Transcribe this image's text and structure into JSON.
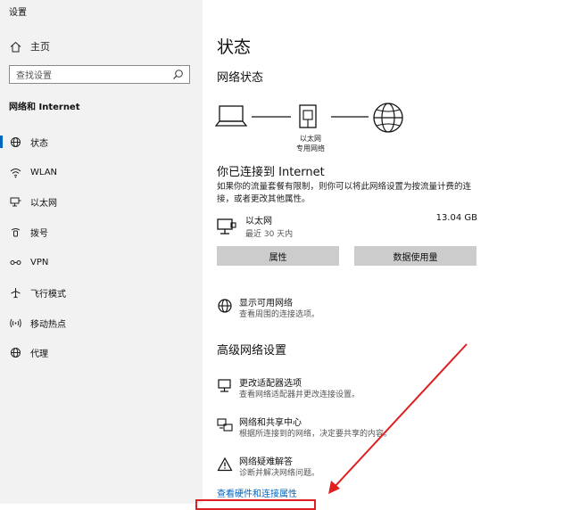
{
  "window": {
    "title": "设置"
  },
  "sidebar": {
    "home_label": "主页",
    "search_placeholder": "查找设置",
    "section_title": "网络和 Internet",
    "items": [
      {
        "label": "状态",
        "icon": "globe-status-icon",
        "active": true
      },
      {
        "label": "WLAN",
        "icon": "wifi-icon",
        "active": false
      },
      {
        "label": "以太网",
        "icon": "ethernet-icon",
        "active": false
      },
      {
        "label": "拨号",
        "icon": "dialup-icon",
        "active": false
      },
      {
        "label": "VPN",
        "icon": "vpn-icon",
        "active": false
      },
      {
        "label": "飞行模式",
        "icon": "airplane-icon",
        "active": false
      },
      {
        "label": "移动热点",
        "icon": "hotspot-icon",
        "active": false
      },
      {
        "label": "代理",
        "icon": "globe-icon",
        "active": false
      }
    ]
  },
  "main": {
    "title": "状态",
    "network_status_heading": "网络状态",
    "diagram": {
      "adapter_name": "以太网",
      "network_type": "专用网络"
    },
    "connected_heading": "你已连接到 Internet",
    "connected_desc": "如果你的流量套餐有限制，则你可以将此网络设置为按流量计费的连接，或者更改其他属性。",
    "connection": {
      "name": "以太网",
      "period": "最近 30 天内",
      "usage": "13.04 GB"
    },
    "buttons": {
      "properties": "属性",
      "data_usage": "数据使用量"
    },
    "show_networks": {
      "title": "显示可用网络",
      "subtitle": "查看周围的连接选项。"
    },
    "advanced_heading": "高级网络设置",
    "advanced_items": [
      {
        "title": "更改适配器选项",
        "subtitle": "查看网络适配器并更改连接设置。",
        "icon": "adapter-icon"
      },
      {
        "title": "网络和共享中心",
        "subtitle": "根据所连接到的网络，决定要共享的内容。",
        "icon": "sharing-center-icon"
      },
      {
        "title": "网络疑难解答",
        "subtitle": "诊断并解决网络问题。",
        "icon": "warning-icon"
      }
    ],
    "hardware_link": "查看硬件和连接属性"
  },
  "colors": {
    "accent": "#0067c0",
    "annotation": "#e02020",
    "sidebar_bg": "#f2f2f2",
    "button_bg": "#cccccc"
  }
}
